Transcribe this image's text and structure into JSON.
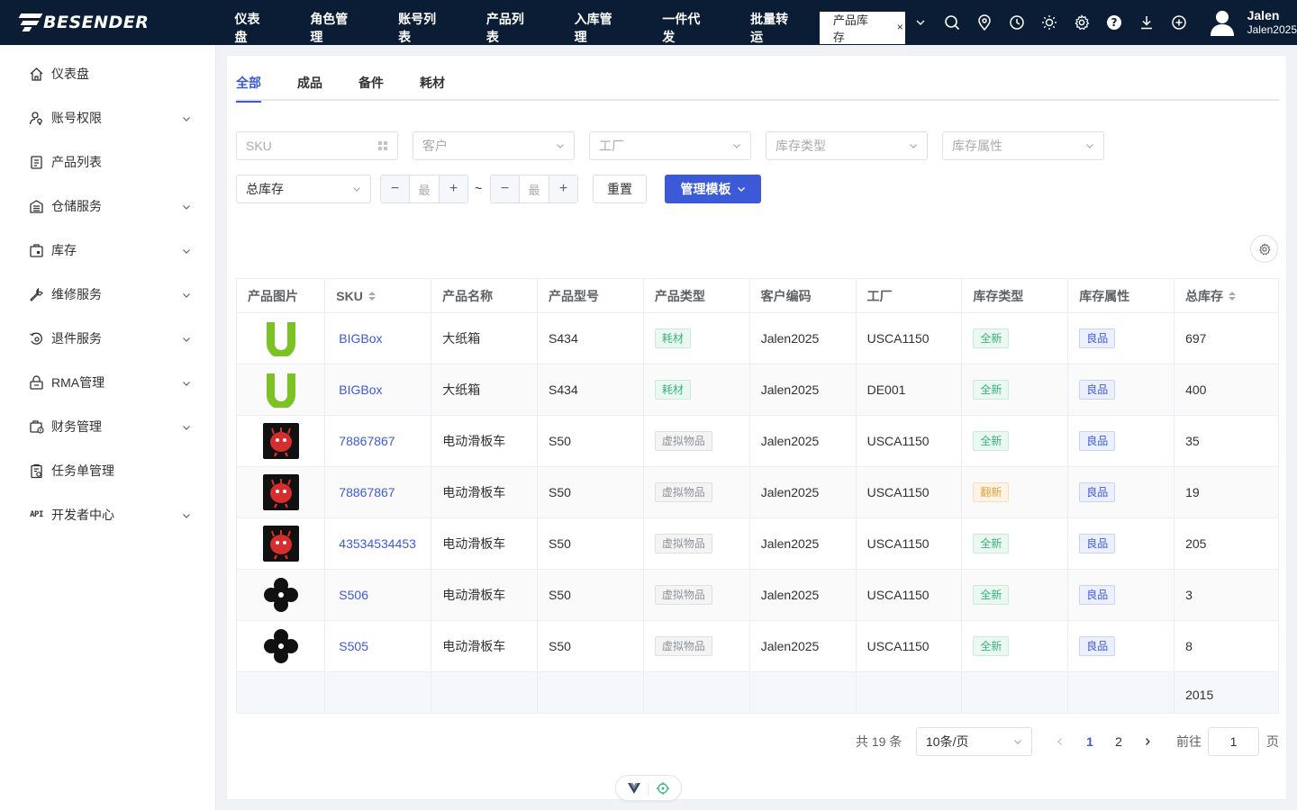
{
  "brand": {
    "name": "BESENDER"
  },
  "topnav": {
    "items": [
      "仪表盘",
      "角色管理",
      "账号列表",
      "产品列表",
      "入库管理",
      "一件代发",
      "批量转运"
    ],
    "active_tab": "产品库存",
    "close_symbol": "×"
  },
  "tool_icons": [
    "search-icon",
    "location-icon",
    "clock-icon",
    "sun-icon",
    "gear-icon",
    "help-icon",
    "download-icon",
    "plus-circle-icon"
  ],
  "user": {
    "name": "Jalen",
    "account": "Jalen2025"
  },
  "sidebar": {
    "items": [
      {
        "label": "仪表盘",
        "icon": "home-icon",
        "expandable": false
      },
      {
        "label": "账号权限",
        "icon": "user-key-icon",
        "expandable": true
      },
      {
        "label": "产品列表",
        "icon": "document-icon",
        "expandable": false
      },
      {
        "label": "仓储服务",
        "icon": "warehouse-icon",
        "expandable": true
      },
      {
        "label": "库存",
        "icon": "inventory-icon",
        "expandable": true
      },
      {
        "label": "维修服务",
        "icon": "wrench-icon",
        "expandable": true
      },
      {
        "label": "退件服务",
        "icon": "return-icon",
        "expandable": true
      },
      {
        "label": "RMA管理",
        "icon": "lock-box-icon",
        "expandable": true
      },
      {
        "label": "财务管理",
        "icon": "finance-icon",
        "expandable": true
      },
      {
        "label": "任务单管理",
        "icon": "task-icon",
        "expandable": false
      },
      {
        "label": "开发者中心",
        "icon": "api-icon",
        "icon_text": "API",
        "expandable": true
      }
    ]
  },
  "tabs": [
    "全部",
    "成品",
    "备件",
    "耗材"
  ],
  "active_tab_index": 0,
  "filters": {
    "sku_placeholder": "SKU",
    "customer_placeholder": "客户",
    "factory_placeholder": "工厂",
    "stock_type_placeholder": "库存类型",
    "stock_attr_placeholder": "库存属性",
    "total_select_value": "总库存",
    "min_placeholder": "最",
    "max_placeholder": "最",
    "minus": "−",
    "plus": "+",
    "range_sep": "~",
    "reset_label": "重置",
    "template_label": "管理模板"
  },
  "table": {
    "columns": [
      "产品图片",
      "SKU",
      "产品名称",
      "产品型号",
      "产品类型",
      "客户编码",
      "工厂",
      "库存类型",
      "库存属性",
      "总库存"
    ],
    "sortable_columns": [
      "SKU",
      "总库存"
    ],
    "rows": [
      {
        "image": "green-u-logo",
        "sku": "BIGBox",
        "name": "大纸箱",
        "model": "S434",
        "type": "耗材",
        "type_color": "green",
        "customer": "Jalen2025",
        "factory": "USCA1150",
        "stock_type": "全新",
        "stock_type_color": "green",
        "attr": "良品",
        "total": "697"
      },
      {
        "image": "green-u-logo",
        "sku": "BIGBox",
        "name": "大纸箱",
        "model": "S434",
        "type": "耗材",
        "type_color": "green",
        "customer": "Jalen2025",
        "factory": "DE001",
        "stock_type": "全新",
        "stock_type_color": "green",
        "attr": "良品",
        "total": "400"
      },
      {
        "image": "red-monster",
        "sku": "78867867",
        "name": "电动滑板车",
        "model": "S50",
        "type": "虚拟物品",
        "type_color": "gray",
        "customer": "Jalen2025",
        "factory": "USCA1150",
        "stock_type": "全新",
        "stock_type_color": "green",
        "attr": "良品",
        "total": "35"
      },
      {
        "image": "red-monster",
        "sku": "78867867",
        "name": "电动滑板车",
        "model": "S50",
        "type": "虚拟物品",
        "type_color": "gray",
        "customer": "Jalen2025",
        "factory": "USCA1150",
        "stock_type": "翻新",
        "stock_type_color": "orange",
        "attr": "良品",
        "total": "19"
      },
      {
        "image": "red-monster",
        "sku": "43534534453",
        "name": "电动滑板车",
        "model": "S50",
        "type": "虚拟物品",
        "type_color": "gray",
        "customer": "Jalen2025",
        "factory": "USCA1150",
        "stock_type": "全新",
        "stock_type_color": "green",
        "attr": "良品",
        "total": "205"
      },
      {
        "image": "black-clover",
        "sku": "S506",
        "name": "电动滑板车",
        "model": "S50",
        "type": "虚拟物品",
        "type_color": "gray",
        "customer": "Jalen2025",
        "factory": "USCA1150",
        "stock_type": "全新",
        "stock_type_color": "green",
        "attr": "良品",
        "total": "3"
      },
      {
        "image": "black-clover",
        "sku": "S505",
        "name": "电动滑板车",
        "model": "S50",
        "type": "虚拟物品",
        "type_color": "gray",
        "customer": "Jalen2025",
        "factory": "USCA1150",
        "stock_type": "全新",
        "stock_type_color": "green",
        "attr": "良品",
        "total": "8"
      }
    ],
    "summary_total": "2015"
  },
  "pagination": {
    "total_text": "共 19 条",
    "page_size": "10条/页",
    "pages": [
      "1",
      "2"
    ],
    "current_page": "1",
    "goto_label": "前往",
    "goto_value": "1",
    "page_unit": "页"
  },
  "colors": {
    "topbar": "#0b1d34",
    "accent": "#3c5ad8",
    "green": "#36b37e",
    "orange": "#e6a23c"
  }
}
